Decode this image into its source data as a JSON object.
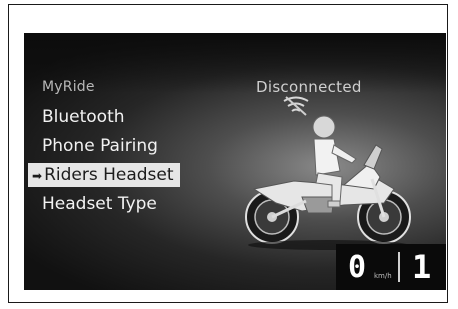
{
  "menu": {
    "title": "MyRide",
    "items": [
      {
        "label": "Bluetooth",
        "selected": false
      },
      {
        "label": "Phone Pairing",
        "selected": false
      },
      {
        "label": "Riders Headset",
        "selected": true
      },
      {
        "label": "Headset Type",
        "selected": false
      }
    ]
  },
  "status": {
    "connection": "Disconnected"
  },
  "cluster": {
    "speed": "0",
    "speed_unit": "km/h",
    "gear": "1"
  },
  "icons": {
    "selection_marker": "arrow-right-icon",
    "signal": "wireless-signal-icon"
  },
  "colors": {
    "highlight_bg": "#e6e6e6",
    "text": "#f2f2f2",
    "screen_bg": "#1a1a1a"
  }
}
